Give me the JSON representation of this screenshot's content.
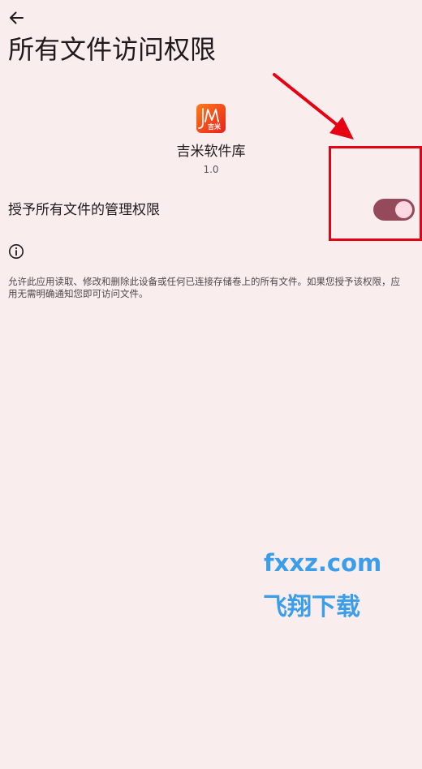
{
  "header": {
    "back_icon": "arrow-left-icon",
    "title": "所有文件访问权限"
  },
  "app": {
    "icon": "jimi-app-logo",
    "icon_text": "吉米",
    "name": "吉米软件库",
    "version": "1.0"
  },
  "permission": {
    "label": "授予所有文件的管理权限",
    "enabled": true
  },
  "info": {
    "icon": "info-icon",
    "text": "允许此应用读取、修改和删除此设备或任何已连接存储卷上的所有文件。如果您授予该权限，应用无需明确通知您即可访问文件。"
  },
  "annotation": {
    "icon": "red-arrow-highlight",
    "color": "#e60012"
  },
  "watermark": {
    "domain": "fxxz.com",
    "name": "飞翔下载",
    "color": "#3b9eea"
  },
  "colors": {
    "background": "#f9eded",
    "toggle_track": "#944a5b",
    "toggle_thumb": "#ffd8e3"
  }
}
